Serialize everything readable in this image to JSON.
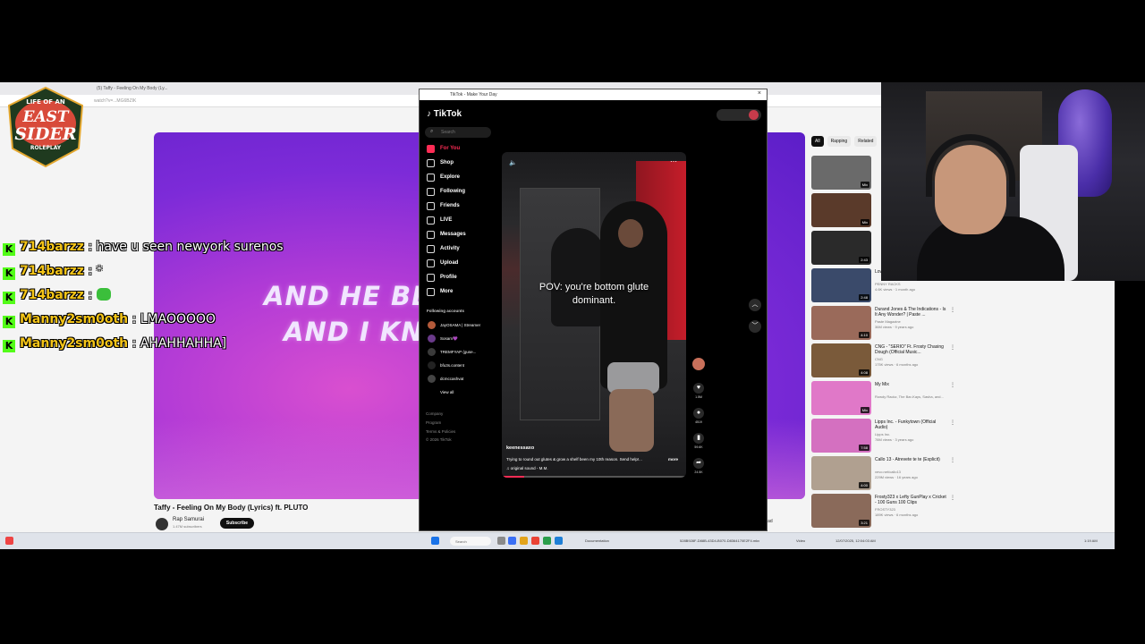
{
  "browser": {
    "tabs": [
      "(5) Taffy - Feeling On My Body (Ly..."
    ],
    "address": "watch?v=...MG6BZIK"
  },
  "youtube": {
    "lyric_line1": "AND HE BE L",
    "lyric_line2": "AND I KNO",
    "video_title": "Taffy - Feeling On My Body (Lyrics) ft. PLUTO",
    "channel": "Rap Samurai",
    "subscribers": "1.47M subscribers",
    "subscribe_label": "Subscribe",
    "download_label": "ownload",
    "chips": [
      "All",
      "Rapping",
      "Related"
    ],
    "recommendations": [
      {
        "title": "",
        "meta1": "",
        "meta2": "",
        "duration": "Mix"
      },
      {
        "title": "",
        "meta1": "",
        "meta2": "",
        "duration": "Mix"
      },
      {
        "title": "",
        "meta1": "",
        "meta2": "",
        "duration": "2:43"
      },
      {
        "title": "Love (Official Music Video)",
        "meta1": "PENNY RACKS",
        "meta2": "4.6K views · 1 month ago",
        "duration": "2:48"
      },
      {
        "title": "Durand Jones & The Indications - Is It Any Wonder? | Paste ...",
        "meta1": "Paste Magazine",
        "meta2": "36M views · 9 years ago",
        "duration": "4:10"
      },
      {
        "title": "CNG - \"SERIO\" Ft. Frosty Chasing Dough (Official Music...",
        "meta1": "CNG",
        "meta2": "175K views · 6 months ago",
        "duration": "4:08"
      },
      {
        "title": "My Mix",
        "meta1": "Rowdy Rackz, The Bar-Kays, Sasha, and...",
        "meta2": "",
        "duration": "Mix"
      },
      {
        "title": "Lipps Inc. - Funkytown (Official Audio)",
        "meta1": "Lipps Inc.",
        "meta2": "78M views · 3 years ago",
        "duration": "7:58"
      },
      {
        "title": "Callo 13 - Atrevete te te (Explicit)",
        "meta1": "vevo.net/callo13",
        "meta2": "229M views · 16 years ago",
        "duration": "4:00"
      },
      {
        "title": "Frosty323 x Lefty GunPlay x Cricket - 100 Guns 100 Clips",
        "meta1": "FROSTY323",
        "meta2": "189K views · 6 months ago",
        "duration": "3:21"
      }
    ]
  },
  "tiktok": {
    "window_title": "TikTok - Make Your Day",
    "logo": "TikTok",
    "search_placeholder": "Search",
    "nav": [
      "For You",
      "Shop",
      "Explore",
      "Following",
      "Friends",
      "LIVE",
      "Messages",
      "Activity",
      "Upload",
      "Profile",
      "More"
    ],
    "following_header": "Following accounts",
    "accounts": [
      "JayOSAMA | Streamer",
      "Sosam💜",
      "TREMFYAP (guse...",
      "bfu3s.content",
      "dcmccashvat"
    ],
    "view_all": "View all",
    "footer": [
      "Company",
      "Program",
      "Terms & Policies",
      "© 2026 TikTok"
    ],
    "caption_line1": "POV: you're bottom glute",
    "caption_line2": "dominant.",
    "username": "keenessaxo",
    "description": "Trying to round out glutes & grow a shelf been my 10th reason. Send help!...",
    "more_label": "more",
    "sound": "♫ original sound - M.M.",
    "progress": 0.12,
    "likes": "1.5M",
    "comments": "4519",
    "saves": "59.6K",
    "shares": "24.5K"
  },
  "taskbar": {
    "search": "Search",
    "items": [
      "Documentation",
      "528B928F-D88B-43D4-B070-D8364170E2F4.mkv",
      "Video",
      "12/07/2025, 12:04:03 AM"
    ],
    "clock": "1:19 AM"
  },
  "overlay": {
    "logo_line1": "LIFE OF AN",
    "logo_line2": "EAST",
    "logo_line3": "SIDER",
    "logo_line4": "ROLEPLAY",
    "chat": [
      {
        "user": "714barzz",
        "msg": ": have u seen newyork surenos"
      },
      {
        "user": "714barzz",
        "msg": ": *"
      },
      {
        "user": "714barzz",
        "msg": ":"
      },
      {
        "user": "Manny2sm0oth",
        "msg": ": LMAOOOOO"
      },
      {
        "user": "Manny2sm0oth",
        "msg": ": AHAHHAHHA]"
      }
    ],
    "chat_user_color": "#f5c518",
    "kick_color": "#53fc18"
  }
}
